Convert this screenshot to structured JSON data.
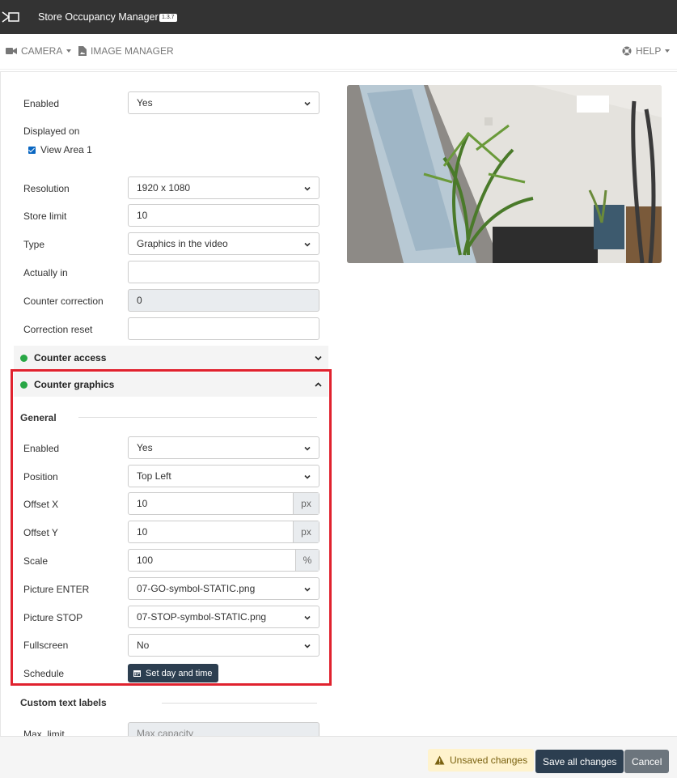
{
  "app": {
    "title": "Store Occupancy Manager",
    "version": "1.3.7"
  },
  "menu": {
    "camera": "CAMERA",
    "image_manager": "IMAGE MANAGER",
    "help": "HELP"
  },
  "form": {
    "enabled": {
      "label": "Enabled",
      "value": "Yes"
    },
    "displayed_on": {
      "label": "Displayed on",
      "option": "View Area 1",
      "checked": true
    },
    "resolution": {
      "label": "Resolution",
      "value": "1920 x 1080"
    },
    "store_limit": {
      "label": "Store limit",
      "value": "10"
    },
    "type": {
      "label": "Type",
      "value": "Graphics in the video"
    },
    "actually_in": {
      "label": "Actually in",
      "value": ""
    },
    "counter_correction": {
      "label": "Counter correction",
      "value": "0"
    },
    "correction_reset": {
      "label": "Correction reset",
      "value": ""
    }
  },
  "sections": {
    "counter_access": "Counter access",
    "counter_graphics": "Counter graphics"
  },
  "graphics": {
    "general_title": "General",
    "enabled": {
      "label": "Enabled",
      "value": "Yes"
    },
    "position": {
      "label": "Position",
      "value": "Top Left"
    },
    "offset_x": {
      "label": "Offset X",
      "value": "10",
      "unit": "px"
    },
    "offset_y": {
      "label": "Offset Y",
      "value": "10",
      "unit": "px"
    },
    "scale": {
      "label": "Scale",
      "value": "100",
      "unit": "%"
    },
    "picture_enter": {
      "label": "Picture ENTER",
      "value": "07-GO-symbol-STATIC.png"
    },
    "picture_stop": {
      "label": "Picture STOP",
      "value": "07-STOP-symbol-STATIC.png"
    },
    "fullscreen": {
      "label": "Fullscreen",
      "value": "No"
    },
    "schedule": {
      "label": "Schedule",
      "button": "Set day and time"
    }
  },
  "custom_text": {
    "title": "Custom text labels",
    "max_limit": {
      "label": "Max. limit",
      "placeholder": "Max capacity"
    }
  },
  "footer": {
    "unsaved": "Unsaved changes",
    "save": "Save all changes",
    "cancel": "Cancel"
  },
  "colors": {
    "topbar": "#333333",
    "primary": "#2c3e50",
    "highlight": "#e0222e",
    "status_green": "#28a745",
    "warning_bg": "#fff3cd"
  }
}
